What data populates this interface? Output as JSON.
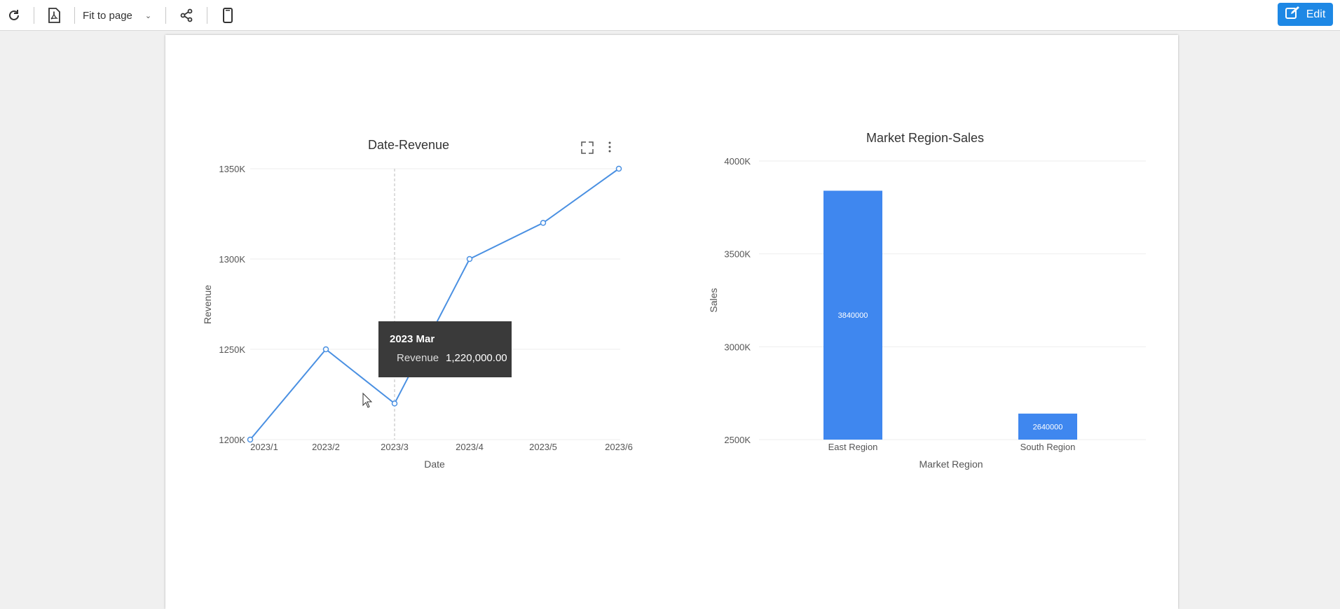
{
  "toolbar": {
    "refresh_icon": "refresh-icon",
    "pdf_icon": "pdf-icon",
    "fit_select_value": "Fit to page",
    "share_icon": "share-icon",
    "mobile_icon": "mobile-icon",
    "edit_label": "Edit",
    "accent_color": "#1e88e5"
  },
  "tooltip": {
    "title": "2023 Mar",
    "label": "Revenue",
    "value": "1,220,000.00"
  },
  "chart_data": [
    {
      "type": "line",
      "title": "Date-Revenue",
      "xlabel": "Date",
      "ylabel": "Revenue",
      "categories": [
        "2023/1",
        "2023/2",
        "2023/3",
        "2023/4",
        "2023/5",
        "2023/6"
      ],
      "values": [
        1200000,
        1250000,
        1220000,
        1300000,
        1320000,
        1350000
      ],
      "ylim": [
        1200000,
        1350000
      ],
      "yticks": [
        1200000,
        1250000,
        1300000,
        1350000
      ],
      "ytick_labels": [
        "1200K",
        "1250K",
        "1300K",
        "1350K"
      ],
      "highlighted_category": "2023/3",
      "line_color": "#4a90e2",
      "grid": true
    },
    {
      "type": "bar",
      "title": "Market Region-Sales",
      "xlabel": "Market Region",
      "ylabel": "Sales",
      "categories": [
        "East Region",
        "South Region"
      ],
      "values": [
        3840000,
        2640000
      ],
      "data_labels": [
        "3840000",
        "2640000"
      ],
      "ylim": [
        2500000,
        4000000
      ],
      "yticks": [
        2500000,
        3000000,
        3500000,
        4000000
      ],
      "ytick_labels": [
        "2500K",
        "3000K",
        "3500K",
        "4000K"
      ],
      "bar_color": "#3f87ef",
      "grid": true
    }
  ]
}
